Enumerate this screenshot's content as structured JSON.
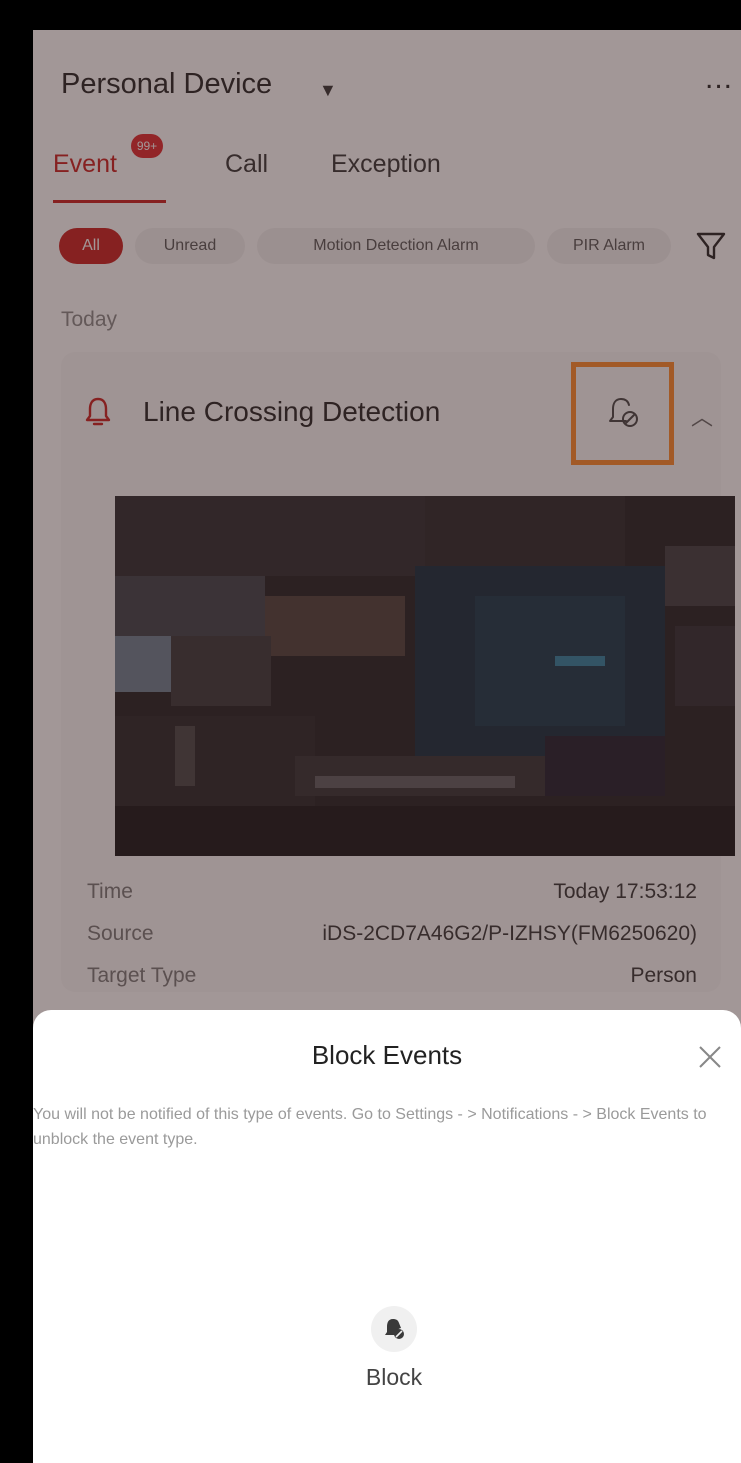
{
  "header": {
    "title": "Personal Device",
    "more": "..."
  },
  "tabs": [
    {
      "label": "Event",
      "badge": "99+",
      "active": true
    },
    {
      "label": "Call",
      "active": false
    },
    {
      "label": "Exception",
      "active": false
    }
  ],
  "filters": [
    {
      "label": "All",
      "active": true
    },
    {
      "label": "Unread",
      "active": false
    },
    {
      "label": "Motion Detection Alarm",
      "active": false
    },
    {
      "label": "PIR Alarm",
      "active": false
    }
  ],
  "section_label": "Today",
  "event": {
    "title": "Line Crossing Detection",
    "details": [
      {
        "label": "Time",
        "value": "Today 17:53:12"
      },
      {
        "label": "Source",
        "value": "iDS-2CD7A46G2/P-IZHSY(FM6250620)"
      },
      {
        "label": "Target Type",
        "value": "Person"
      }
    ]
  },
  "sheet": {
    "title": "Block Events",
    "description": "You will not be notified of this type of events. Go to Settings - > Notifications - > Block Events to unblock the event type.",
    "block_label": "Block"
  },
  "colors": {
    "accent": "#c91d1d",
    "highlight": "#ff8a2a"
  }
}
